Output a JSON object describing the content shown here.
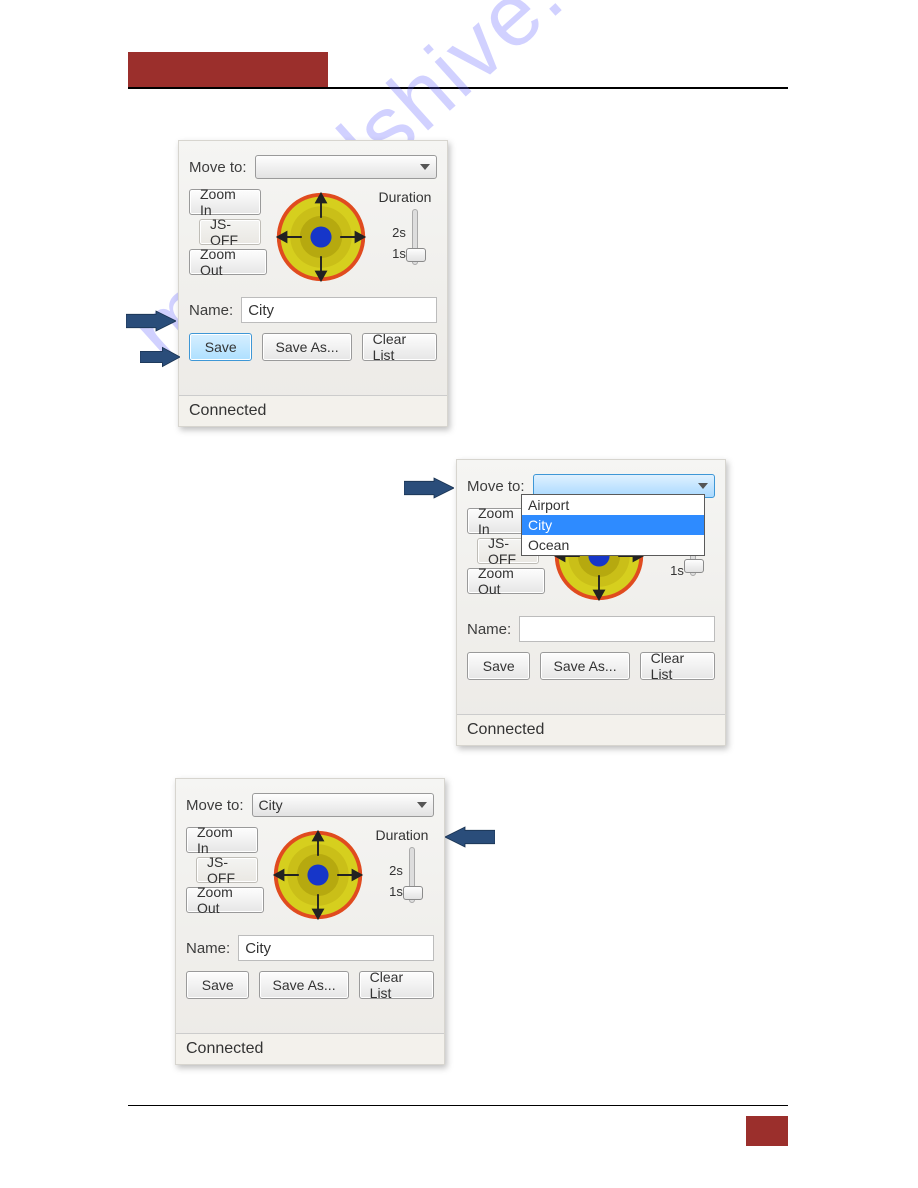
{
  "watermark_text": "manualshive.com",
  "duration_label": "Duration",
  "tick_2s": "2s",
  "tick_1s": "1s",
  "panel1": {
    "move_to_label": "Move to:",
    "move_to_value": "",
    "zoom_in": "Zoom In",
    "js_off": "JS-OFF",
    "zoom_out": "Zoom Out",
    "name_label": "Name:",
    "name_value": "City",
    "save": "Save",
    "save_as": "Save As...",
    "clear_list": "Clear List",
    "status": "Connected"
  },
  "panel2": {
    "move_to_label": "Move to:",
    "move_to_value": "",
    "dd_items": [
      "Airport",
      "City",
      "Ocean"
    ],
    "dd_selected_index": 1,
    "zoom_in": "Zoom In",
    "js_off": "JS-OFF",
    "zoom_out": "Zoom Out",
    "name_label": "Name:",
    "name_value": "",
    "save": "Save",
    "save_as": "Save As...",
    "clear_list": "Clear List",
    "status": "Connected"
  },
  "panel3": {
    "move_to_label": "Move to:",
    "move_to_value": "City",
    "zoom_in": "Zoom In",
    "js_off": "JS-OFF",
    "zoom_out": "Zoom Out",
    "name_label": "Name:",
    "name_value": "City",
    "save": "Save",
    "save_as": "Save As...",
    "clear_list": "Clear List",
    "status": "Connected"
  }
}
